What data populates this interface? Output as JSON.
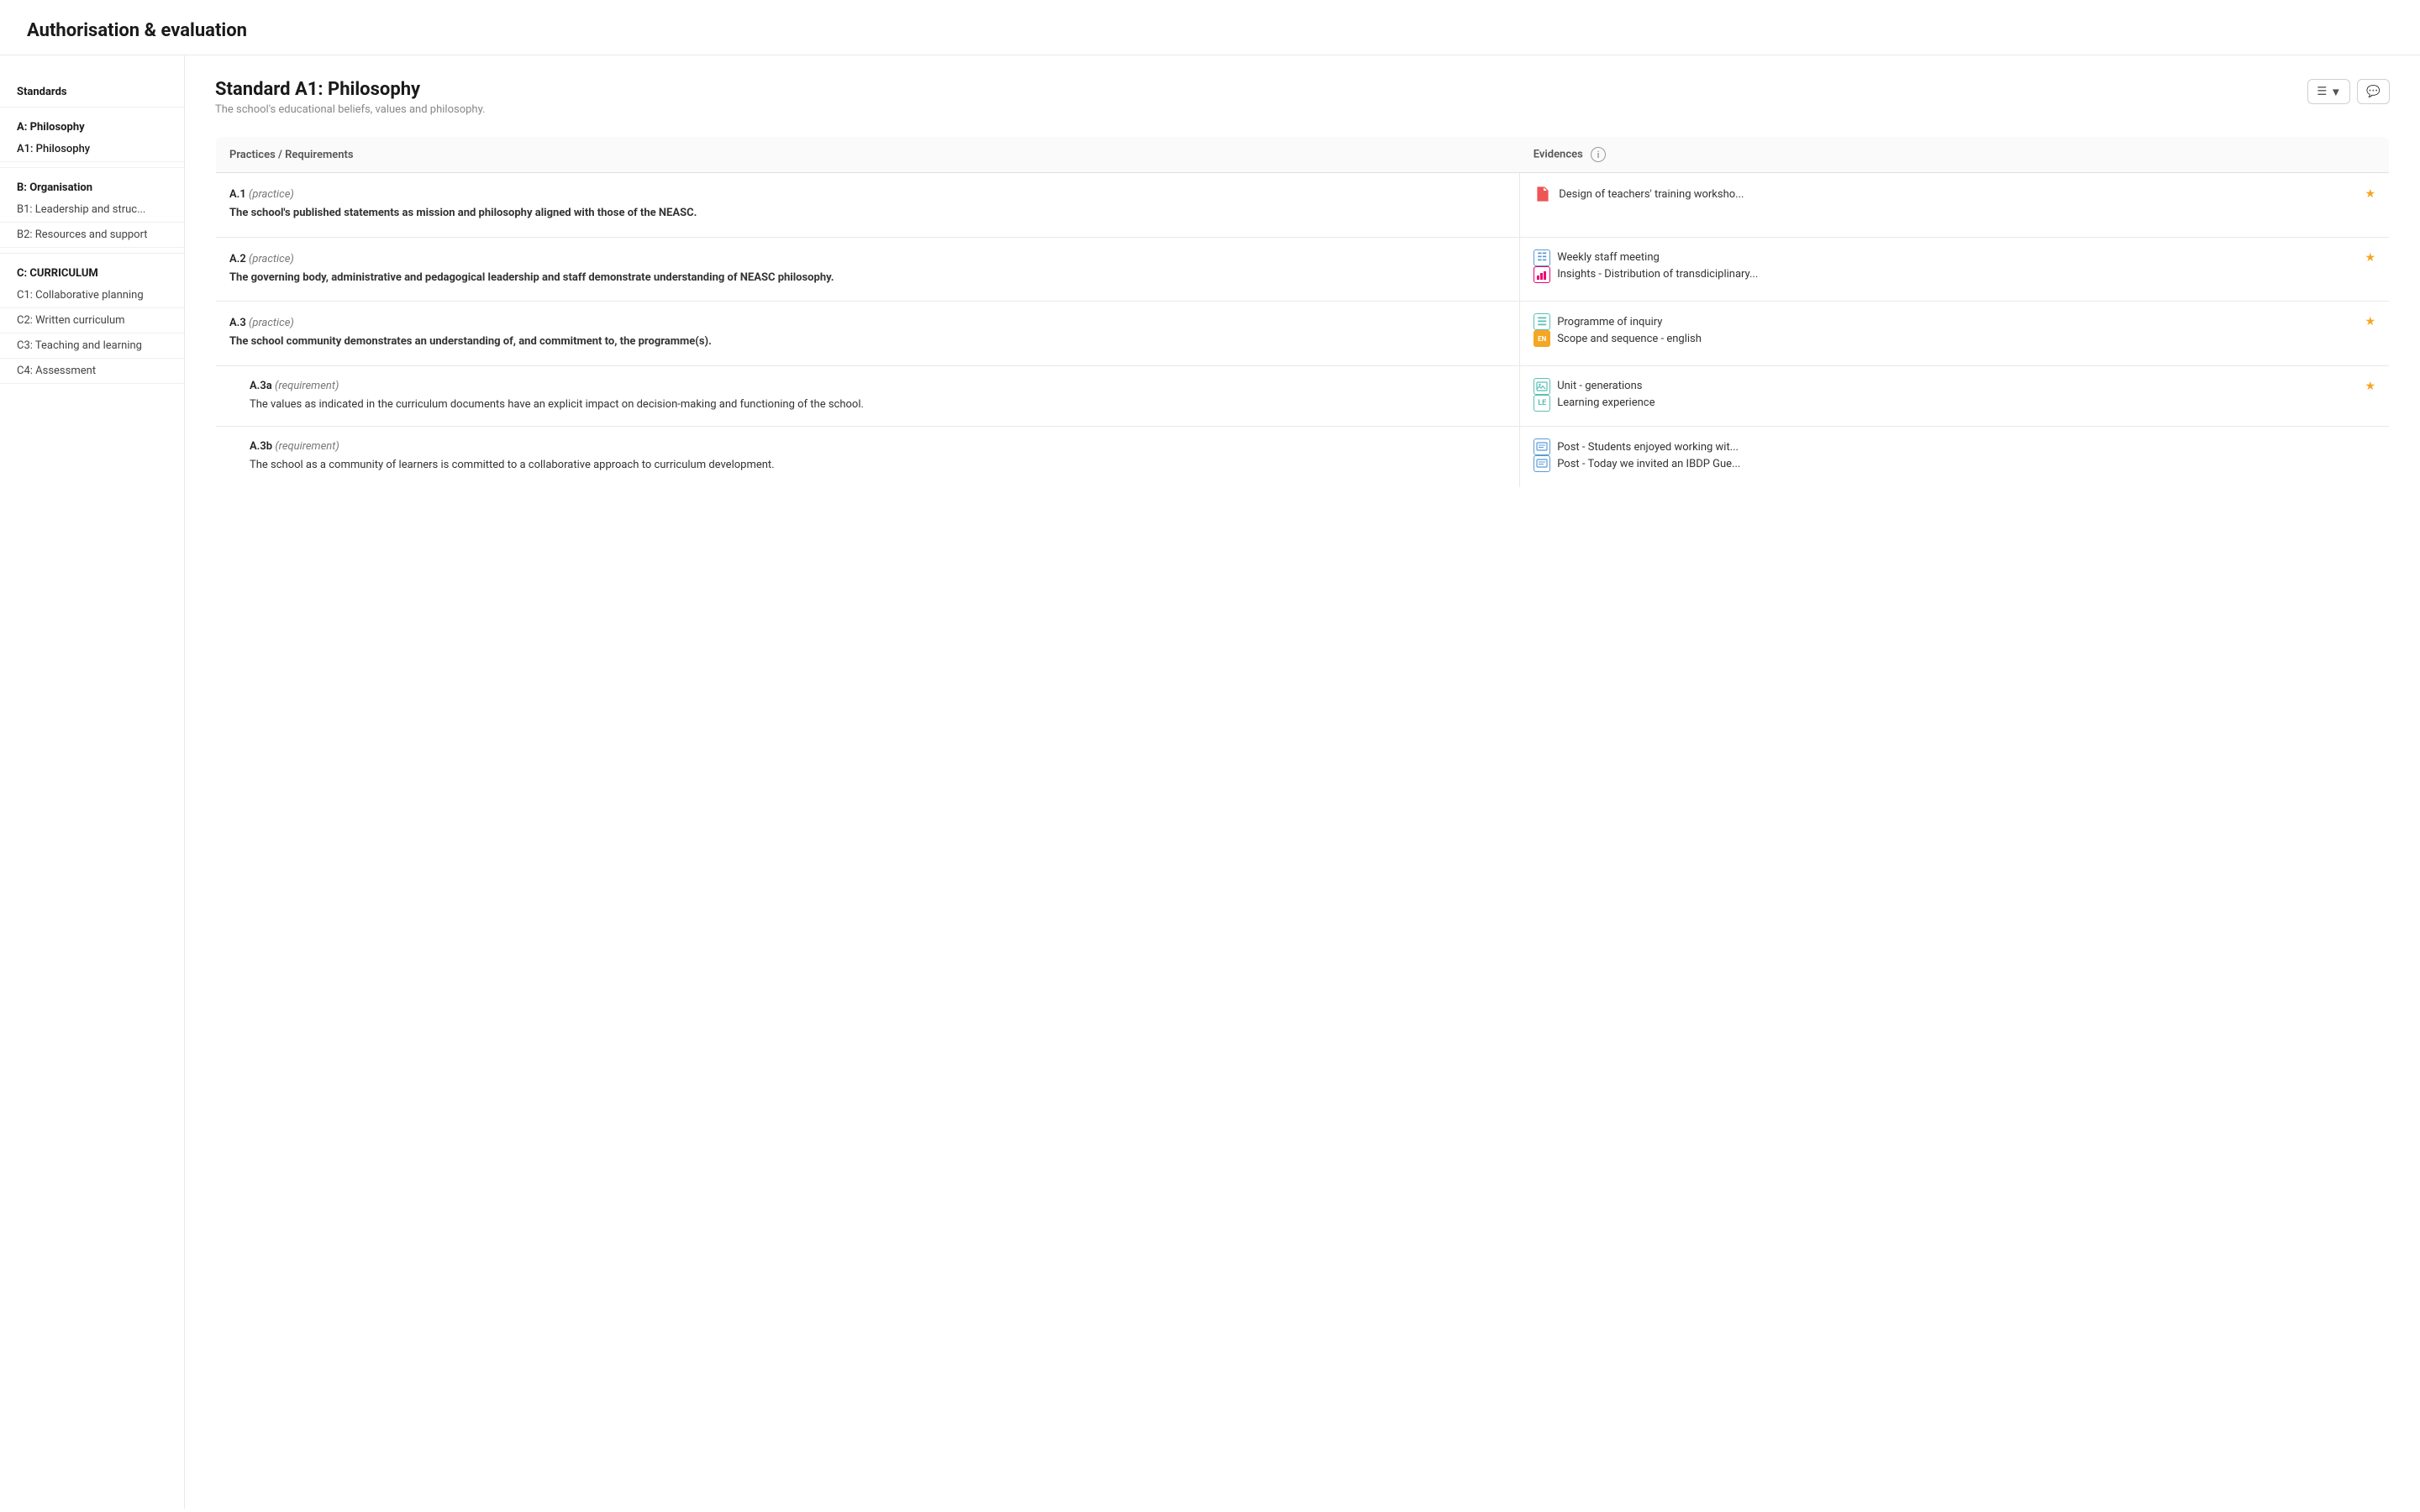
{
  "header": {
    "title": "Authorisation & evaluation"
  },
  "sidebar": {
    "standards_label": "Standards",
    "sections": [
      {
        "header": "A: Philosophy",
        "items": [
          {
            "label": "A1: Philosophy",
            "active": true
          }
        ]
      },
      {
        "header": "B: Organisation",
        "items": [
          {
            "label": "B1: Leadership and struc...",
            "active": false
          },
          {
            "label": "B2: Resources and support",
            "active": false
          }
        ]
      },
      {
        "header": "C: CURRICULUM",
        "items": [
          {
            "label": "C1: Collaborative planning",
            "active": false
          },
          {
            "label": "C2: Written curriculum",
            "active": false
          },
          {
            "label": "C3: Teaching and learning",
            "active": false
          },
          {
            "label": "C4: Assessment",
            "active": false
          }
        ]
      }
    ]
  },
  "main": {
    "standard_title": "Standard A1: Philosophy",
    "standard_subtitle": "The school's educational beliefs, values and philosophy.",
    "toolbar": {
      "list_btn": "≡",
      "comment_btn": "💬"
    },
    "table": {
      "col_practice": "Practices / Requirements",
      "col_evidence": "Evidences",
      "rows": [
        {
          "id": "A.1",
          "type": "practice",
          "text_bold": "The school's published statements as mission and philosophy aligned with those of the NEASC.",
          "evidences": [
            {
              "icon_type": "pdf",
              "label": "Design of teachers' training worksho...",
              "starred": true
            }
          ]
        },
        {
          "id": "A.2",
          "type": "practice",
          "text_bold": "The governing body, administrative and pedagogical leadership and staff demonstrate understanding of NEASC philosophy.",
          "evidences": [
            {
              "icon_type": "table",
              "label": "Weekly staff meeting",
              "starred": true
            },
            {
              "icon_type": "chart",
              "label": "Insights - Distribution of transdiciplinary...",
              "starred": false
            }
          ]
        },
        {
          "id": "A.3",
          "type": "practice",
          "text_bold": "The school community demonstrates an understanding of, and commitment to, the programme(s).",
          "evidences": [
            {
              "icon_type": "poi",
              "label": "Programme of inquiry",
              "starred": true
            },
            {
              "icon_type": "scope",
              "label": "Scope and sequence - english",
              "starred": false
            }
          ]
        },
        {
          "id": "A.3a",
          "type": "requirement",
          "text": "The values as indicated in the curriculum documents have an explicit impact on decision-making and functioning of the school.",
          "evidences": [
            {
              "icon_type": "image",
              "label": "Unit - generations",
              "starred": true
            },
            {
              "icon_type": "le",
              "label": "Learning experience",
              "starred": false
            }
          ]
        },
        {
          "id": "A.3b",
          "type": "requirement",
          "text": "The school as a community of learners is committed to a collaborative approach to curriculum development.",
          "evidences": [
            {
              "icon_type": "post",
              "label": "Post - Students enjoyed working wit...",
              "starred": false
            },
            {
              "icon_type": "post",
              "label": "Post - Today we invited an IBDP Gue...",
              "starred": false
            }
          ]
        }
      ]
    }
  }
}
